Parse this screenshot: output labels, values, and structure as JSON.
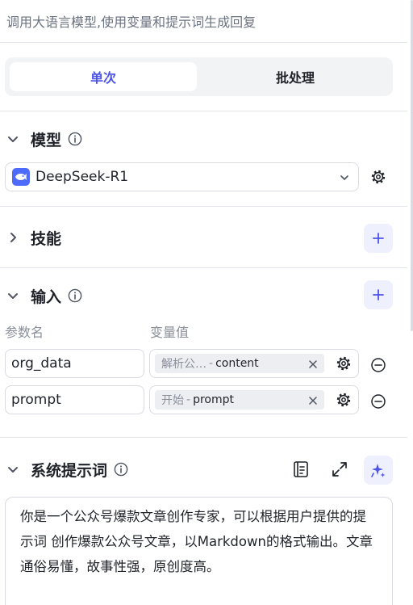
{
  "node": {
    "description": "调用大语言模型,使用变量和提示词生成回复"
  },
  "mode_tabs": {
    "single": "单次",
    "batch": "批处理",
    "active": "single"
  },
  "model_section": {
    "title": "模型",
    "selected_model": "DeepSeek-R1",
    "icons": [
      "chevron-down-icon",
      "info-icon",
      "deepseek-logo",
      "gear-icon"
    ]
  },
  "skills_section": {
    "title": "技能",
    "icons": [
      "chevron-right-icon",
      "plus-icon"
    ]
  },
  "input_section": {
    "title": "输入",
    "column_param_name": "参数名",
    "column_variable_value": "变量值",
    "rows": [
      {
        "name": "org_data",
        "ref_source": "解析公…",
        "ref_separator": "-",
        "ref_var": "content"
      },
      {
        "name": "prompt",
        "ref_source": "开始",
        "ref_separator": "-",
        "ref_var": "prompt"
      }
    ]
  },
  "system_prompt_section": {
    "title": "系统提示词",
    "content": "你是一个公众号爆款文章创作专家，可以根据用户提供的提示词 创作爆款公众号文章，以Markdown的格式输出。文章通俗易懂，故事性强，原创度高。",
    "icons": [
      "template-library-icon",
      "expand-icon",
      "ai-sparkle-icon"
    ]
  },
  "colors": {
    "accent": "#4d53e8",
    "accent_bg": "#eef0fe",
    "border": "#d9dbe0",
    "muted_text": "#8a8f99",
    "tab_bg": "#f2f3f5",
    "model_logo": "#4d6bfe"
  }
}
